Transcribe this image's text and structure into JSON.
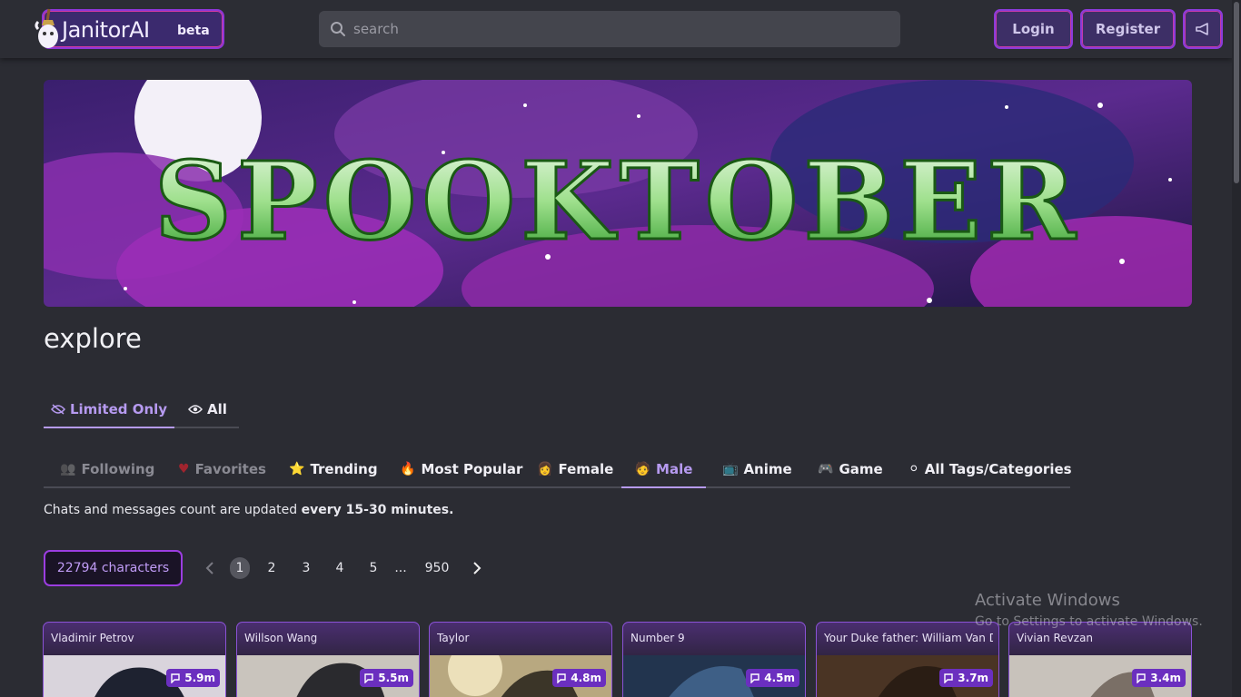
{
  "header": {
    "logo_text": "JanitorAI",
    "logo_badge": "beta",
    "search_placeholder": "search",
    "login_label": "Login",
    "register_label": "Register"
  },
  "banner": {
    "text": "SPOOKTOBER"
  },
  "page_title": "explore",
  "filter_tabs": [
    {
      "label": "Limited Only",
      "icon": "eye-slash-icon",
      "active": true
    },
    {
      "label": "All",
      "icon": "eye-icon",
      "active": false
    }
  ],
  "category_tabs": [
    {
      "label": "Following",
      "icon": "👥"
    },
    {
      "label": "Favorites",
      "icon": "♥"
    },
    {
      "label": "Trending",
      "icon": "⭐"
    },
    {
      "label": "Most Popular",
      "icon": "🔥"
    },
    {
      "label": "Female",
      "icon": "👩"
    },
    {
      "label": "Male",
      "icon": "🧑"
    },
    {
      "label": "Anime",
      "icon": "📺"
    },
    {
      "label": "Game",
      "icon": "🎮"
    },
    {
      "label": "All Tags/Categories",
      "icon": "⚪"
    }
  ],
  "note": {
    "prefix": "Chats and messages count are updated ",
    "emphasis": "every 15-30 minutes."
  },
  "character_count": {
    "number": "22794",
    "label": "characters"
  },
  "pagination": {
    "pages": [
      "1",
      "2",
      "3",
      "4",
      "5"
    ],
    "ellipsis": "...",
    "last": "950",
    "current": "1"
  },
  "cards": [
    {
      "name": "Vladimir Petrov",
      "count": "5.9m"
    },
    {
      "name": "Willson Wang",
      "count": "5.5m"
    },
    {
      "name": "Taylor",
      "count": "4.8m"
    },
    {
      "name": "Number 9",
      "count": "4.5m"
    },
    {
      "name": "Your Duke father: William Van D",
      "count": "3.7m"
    },
    {
      "name": "Vivian Revzan",
      "count": "3.4m"
    }
  ],
  "watermark": {
    "title": "Activate Windows",
    "subtitle": "Go to Settings to activate Windows."
  },
  "colors": {
    "accent": "#b69af0",
    "brand_border": "#9b3de0",
    "background": "#2b2c33"
  }
}
